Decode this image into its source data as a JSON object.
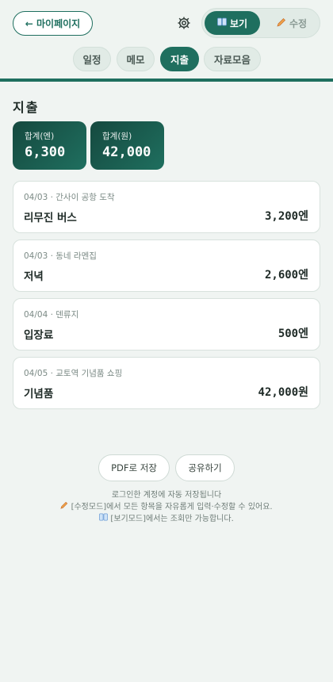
{
  "header": {
    "back_label": "← 마이페이지",
    "mode": {
      "view_label": "보기",
      "edit_label": "수정"
    }
  },
  "tabs": [
    {
      "label": "일정"
    },
    {
      "label": "메모"
    },
    {
      "label": "지출"
    },
    {
      "label": "자료모음"
    }
  ],
  "section_title": "지출",
  "totals": [
    {
      "label": "합계(엔)",
      "value": "6,300"
    },
    {
      "label": "합계(원)",
      "value": "42,000"
    }
  ],
  "expenses": [
    {
      "meta": "04/03 · 간사이 공항 도착",
      "name": "리무진 버스",
      "amount": "3,200엔"
    },
    {
      "meta": "04/03 · 동네 라멘집",
      "name": "저녁",
      "amount": "2,600엔"
    },
    {
      "meta": "04/04 · 덴류지",
      "name": "입장료",
      "amount": "500엔"
    },
    {
      "meta": "04/05 · 교토역 기념품 쇼핑",
      "name": "기념품",
      "amount": "42,000원"
    }
  ],
  "actions": {
    "pdf_label": "PDF로 저장",
    "share_label": "공유하기"
  },
  "footer": {
    "line1": "로그인한 계정에 자동 저장됩니다",
    "line2": "[수정모드]에서 모든 항목을 자유롭게 입력·수정할 수 있어요.",
    "line3": "[보기모드]에서는 조회만 가능합니다."
  },
  "colors": {
    "accent": "#1f6f5f",
    "background": "#f0f4f2"
  }
}
